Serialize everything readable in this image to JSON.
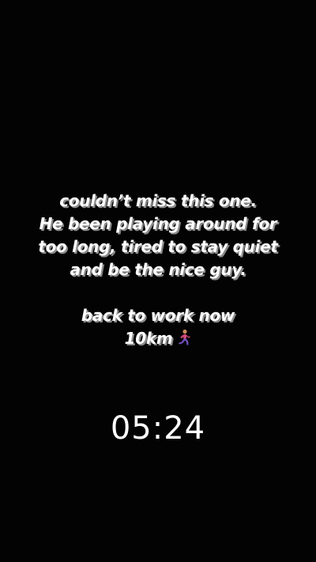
{
  "caption": {
    "lines": [
      "couldn’t miss this one.",
      "He been playing around for",
      "too long, tired to stay quiet",
      "and be the nice guy.",
      "back to work now",
      "10km"
    ],
    "emoji": "person-running-icon"
  },
  "timer": {
    "value": "05:24"
  },
  "colors": {
    "background": "#030303",
    "text": "#ffffff",
    "shadow": "#8a8a8a"
  }
}
